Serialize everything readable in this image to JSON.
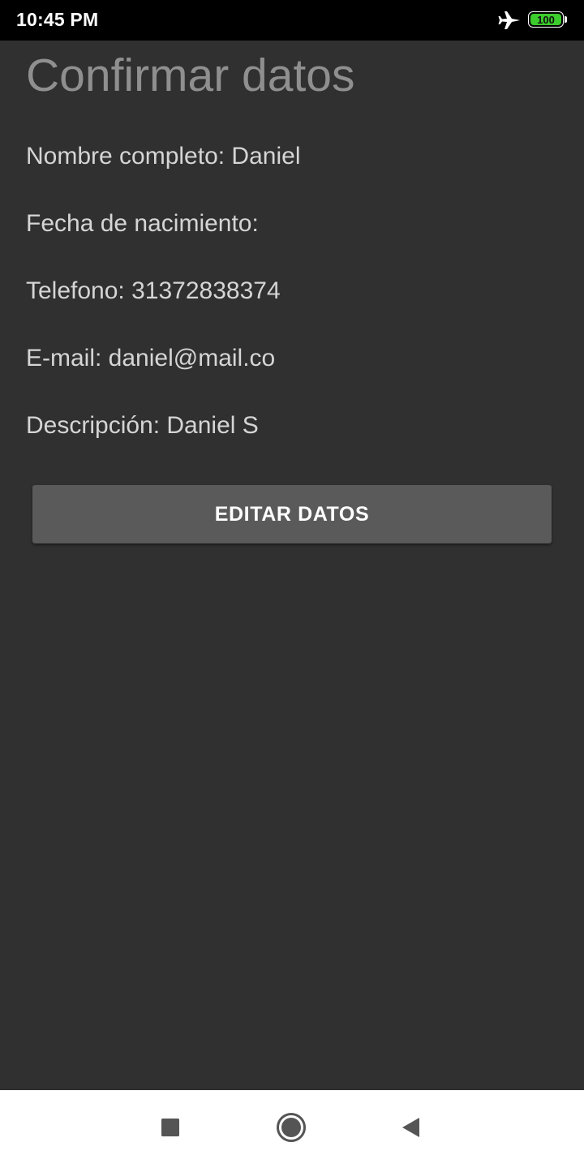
{
  "status_bar": {
    "time": "10:45 PM",
    "battery_level": "100",
    "icons": [
      "airplane-icon",
      "battery-icon"
    ],
    "colors": {
      "background": "#000000",
      "battery_fill": "#3ccc2c"
    }
  },
  "screen": {
    "title": "Confirmar datos",
    "fields": {
      "name": "Nombre completo: Daniel",
      "birth_date": "Fecha de nacimiento:",
      "phone": "Telefono: 31372838374",
      "email": "E-mail: daniel@mail.co",
      "description": "Descripción: Daniel S"
    },
    "edit_button_label": "EDITAR DATOS",
    "colors": {
      "background": "#303030",
      "title": "#8f8f8f",
      "text": "#d5d5d5",
      "button": "#5a5a5b"
    }
  },
  "nav_bar": {
    "icons": [
      "recents-square-icon",
      "home-circle-icon",
      "back-triangle-icon"
    ]
  }
}
